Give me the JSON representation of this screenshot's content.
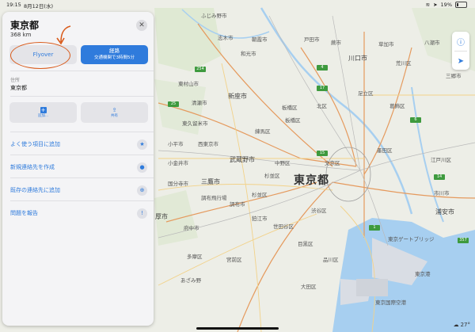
{
  "status_bar": {
    "time": "19:15",
    "date": "8月12日(水)",
    "battery_text": "19%",
    "battery_level": 0.19
  },
  "panel": {
    "title": "東京都",
    "distance": "368 km",
    "flyover_label": "Flyover",
    "route_label": "経路",
    "route_sub": "交通機関で3時間5分",
    "address_label": "住所",
    "address_value": "東京都",
    "actions": [
      {
        "label": "追加...",
        "icon": "plus-square-icon"
      },
      {
        "label": "共有",
        "icon": "share-icon"
      }
    ],
    "rows": [
      {
        "label": "よく使う項目に追加",
        "icon": "star-icon"
      },
      {
        "label": "新規連絡先を作成",
        "icon": "person-icon"
      },
      {
        "label": "既存の連絡先に追加",
        "icon": "person-add-icon"
      },
      {
        "label": "問題を報告",
        "icon": "report-icon"
      }
    ]
  },
  "map": {
    "main_label": "東京都",
    "labels": [
      "ふじみ野市",
      "志木市",
      "朝霞市",
      "和光市",
      "新座市",
      "清瀬市",
      "東久留米市",
      "西東京市",
      "武蔵野市",
      "三鷹市",
      "小金井市",
      "府中市",
      "調布市",
      "狛江市",
      "世田谷区",
      "渋谷区",
      "杉並区",
      "中野区",
      "練馬区",
      "板橋区",
      "北区",
      "足立区",
      "葛飾区",
      "江戸川区",
      "墨田区",
      "荒川区",
      "文京区",
      "品川区",
      "大田区",
      "目黒区",
      "宮前区",
      "浦安市",
      "市川市",
      "八潮市",
      "三郷市",
      "戸田市",
      "蕨市",
      "川口市",
      "草加市",
      "東村山市",
      "小平市",
      "国分寺市",
      "多摩区",
      "あざみ野",
      "東京港",
      "東京ゲートブリッジ",
      "調布飛行場",
      "東京国際空港",
      "杉並区",
      "厚市",
      "板橋区"
    ],
    "route_shields": [
      "254",
      "17",
      "6",
      "25",
      "15",
      "1",
      "14",
      "4",
      "357"
    ],
    "accent": "#2f7bdc",
    "annotation_color": "#d95a1a"
  },
  "controls": {
    "info_icon": "info-icon",
    "location_icon": "location-arrow-icon"
  },
  "weather": {
    "temp": "27°",
    "icon": "cloud-icon"
  }
}
